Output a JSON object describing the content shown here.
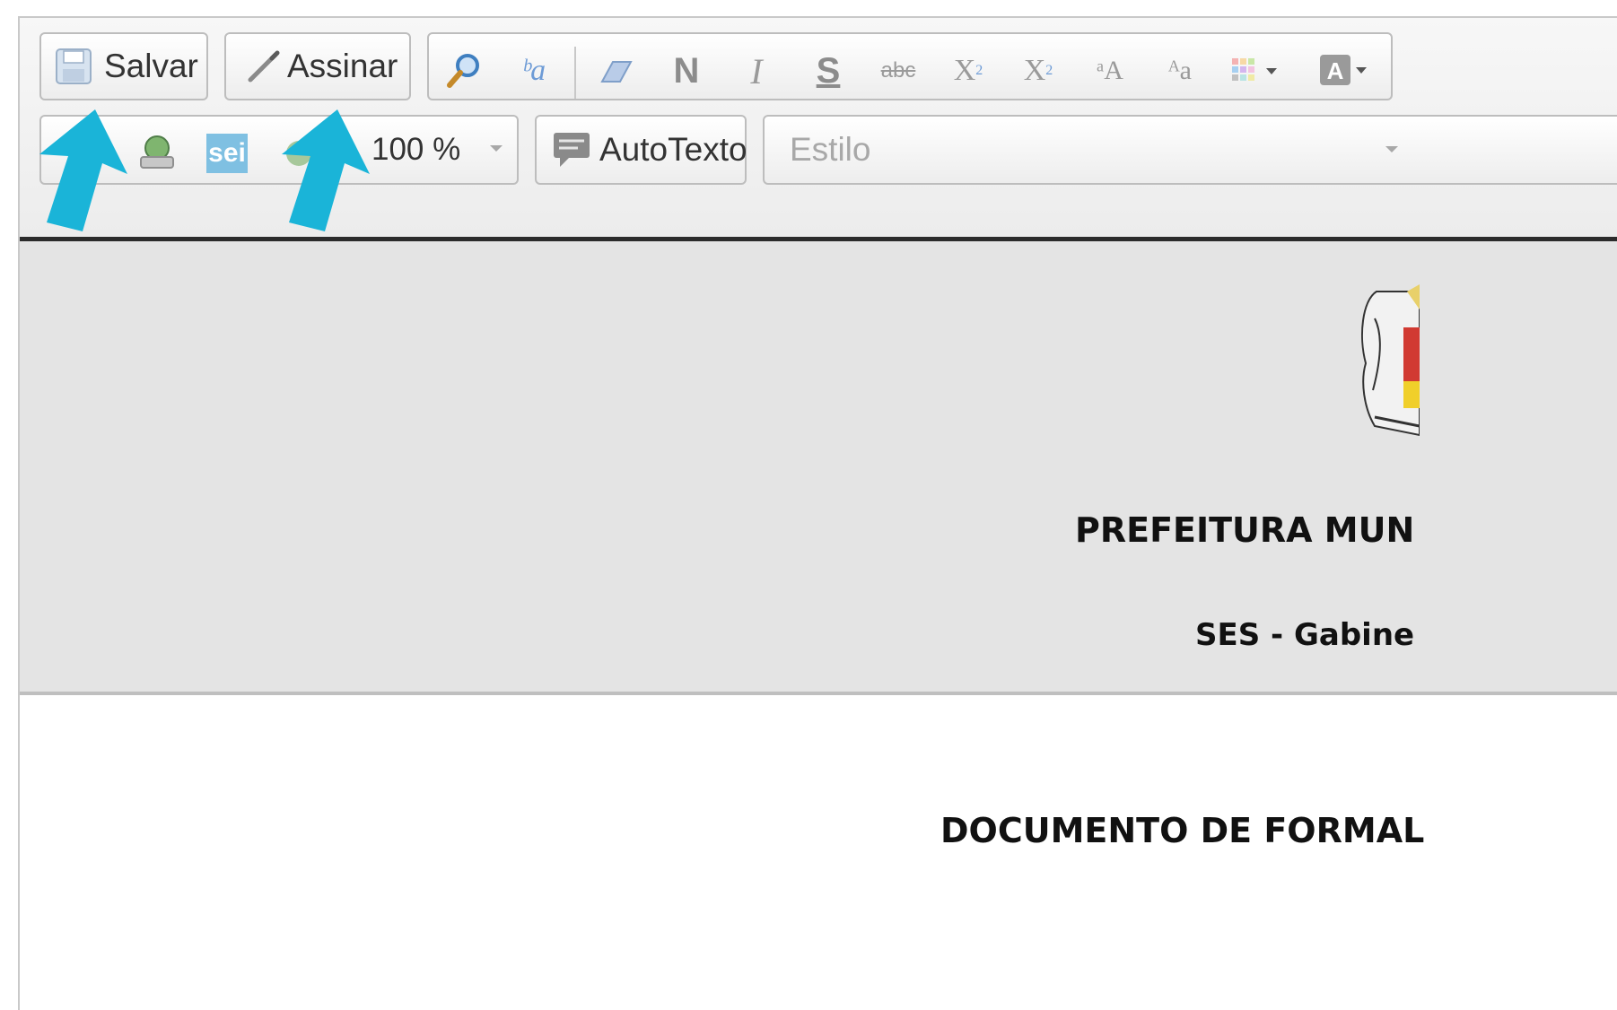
{
  "toolbar": {
    "save_label": "Salvar",
    "sign_label": "Assinar",
    "zoom_value": "100 %",
    "autotext_label": "AutoTexto",
    "style_placeholder": "Estilo",
    "format_tools": [
      {
        "name": "find-icon",
        "glyph": "🔎"
      },
      {
        "name": "replace-icon",
        "glyph": "ᵇa"
      },
      {
        "name": "eraser-icon",
        "glyph": "⌫"
      },
      {
        "name": "bold-icon",
        "glyph": "N"
      },
      {
        "name": "italic-icon",
        "glyph": "I"
      },
      {
        "name": "underline-icon",
        "glyph": "S"
      },
      {
        "name": "strikethrough-icon",
        "glyph": "abc"
      },
      {
        "name": "subscript-icon",
        "glyph": "X₂"
      },
      {
        "name": "superscript-icon",
        "glyph": "X²"
      },
      {
        "name": "uppercase-icon",
        "glyph": "aA"
      },
      {
        "name": "lowercase-icon",
        "glyph": "Aa"
      },
      {
        "name": "table-color-icon",
        "glyph": "▦"
      },
      {
        "name": "text-color-icon",
        "glyph": "A"
      }
    ],
    "sei_logo": "sei"
  },
  "document": {
    "header_line1": "PREFEITURA MUN",
    "header_line2": "SES - Gabine",
    "title": "DOCUMENTO DE FORMAL"
  },
  "colors": {
    "annotation_arrow": "#1ab4d8",
    "header_band": "#e4e4e4"
  }
}
